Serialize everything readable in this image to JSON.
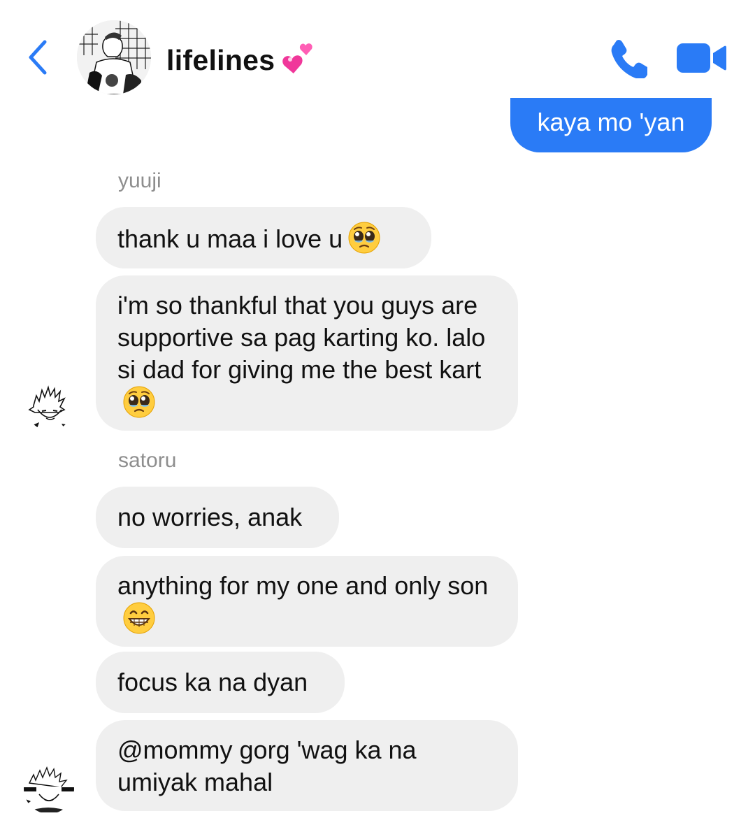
{
  "header": {
    "back_icon": "chevron-left-icon",
    "title": "lifelines",
    "title_emoji": "two-hearts-emoji",
    "call_icon": "phone-icon",
    "video_icon": "video-camera-icon",
    "accent_color": "#2a7bf6"
  },
  "messages": {
    "outgoing": {
      "text": "kaya mo 'yan",
      "color": "#2a7bf6"
    },
    "yuuji": {
      "sender": "yuuji",
      "m1": "thank u maa i love u",
      "m1_emoji": "pleading-face-emoji",
      "m2": "i'm so thankful that you guys are supportive sa pag karting ko. lalo si dad for giving me the best kart",
      "m2_emoji": "pleading-face-emoji"
    },
    "satoru": {
      "sender": "satoru",
      "m1": "no worries, anak",
      "m2": "anything for my one and only son",
      "m2_emoji": "grinning-face-emoji",
      "m3": "focus ka na dyan",
      "m4": "@mommy gorg 'wag ka na umiyak mahal"
    },
    "incoming_bubble_color": "#efefef",
    "sender_label_color": "#8e8e8e"
  }
}
